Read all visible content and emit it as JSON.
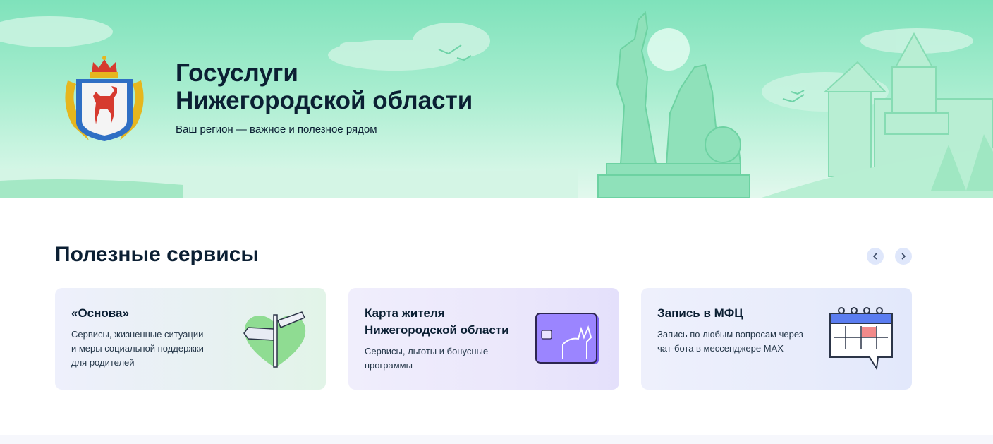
{
  "hero": {
    "title": "Госуслуги\nНижегородской области",
    "subtitle": "Ваш регион — важное и полезное рядом",
    "crest_icon": "nizhny-novgorod-coat-of-arms"
  },
  "services": {
    "title": "Полезные сервисы",
    "prev_icon": "chevron-left-icon",
    "next_icon": "chevron-right-icon",
    "cards": [
      {
        "title": "«Основа»",
        "text": "Сервисы, жизненные ситуации\nи меры социальной поддержки\nдля родителей",
        "icon": "signpost-heart-icon"
      },
      {
        "title": "Карта жителя\nНижегородской области",
        "text": "Сервисы, льготы и бонусные\nпрограммы",
        "icon": "resident-card-icon"
      },
      {
        "title": "Запись в МФЦ",
        "text": "Запись по любым вопросам через\nчат-бота в мессенджере MAX",
        "icon": "calendar-chat-icon"
      }
    ]
  },
  "colors": {
    "hero_bg": "#a7edcf",
    "accent_green": "#5ccf95",
    "nav_button_bg": "#dfe7fb",
    "text": "#0b1f33"
  }
}
